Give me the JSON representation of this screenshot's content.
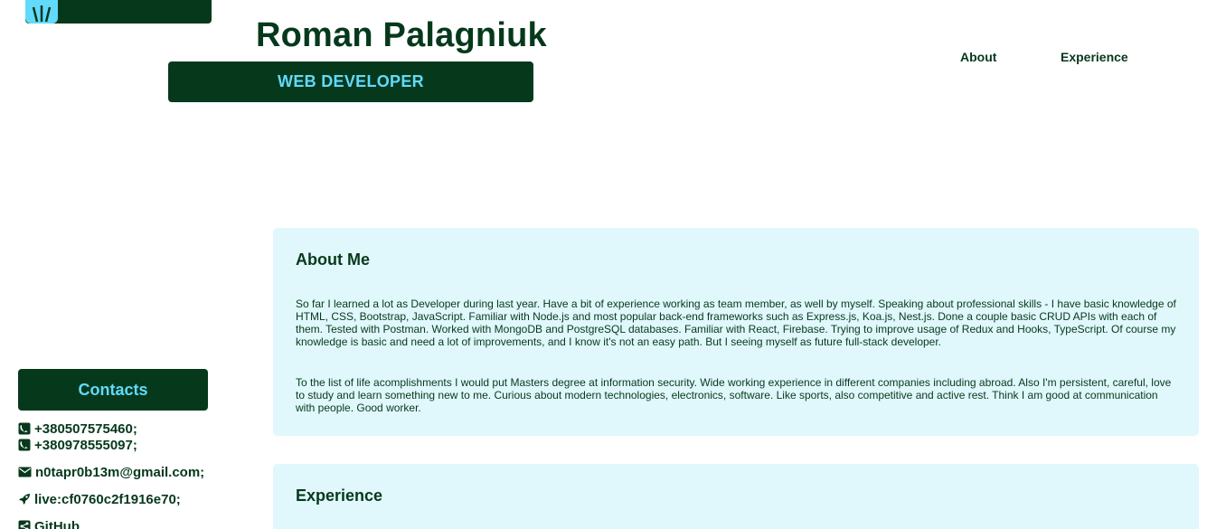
{
  "header": {
    "avatar_icon": "react-logo-icon",
    "name": "Roman Palagniuk",
    "role": "WEB DEVELOPER"
  },
  "nav": {
    "about": "About",
    "experience": "Experience"
  },
  "contacts": {
    "heading": "Contacts",
    "phone1": "+380507575460;",
    "phone2": "+380978555097;",
    "email": "n0tapr0b13m@gmail.com;",
    "skype": "live:cf0760c2f1916e70;",
    "github": "GitHub"
  },
  "about": {
    "heading": "About Me",
    "paragraph1": "So far I learned a lot as Developer during last year. Have a bit of experience working as team member, as well by myself. Speaking about professional skills - I have basic knowledge of HTML, CSS, Bootstrap, JavaScript. Familiar with Node.js and most popular back-end frameworks such as Express.js, Koa.js, Nest.js. Done a couple basic CRUD APIs with each of them. Tested with Postman. Worked with MongoDB and PostgreSQL databases. Familiar with React, Firebase. Trying to improve usage of Redux and Hooks, TypeScript. Of course my knowledge is basic and need a lot of improvements, and I know it's not an easy path. But I seeing myself as future full-stack developer.",
    "paragraph2": "To the list of life acomplishments I would put Masters degree at information security. Wide working experience in different companies including abroad. Also I'm persistent, careful, love to study and learn something new to me. Curious about modern technologies, electronics, software. Like sports, also competitive and active rest. Think I am good at communication with people. Good worker."
  },
  "experience": {
    "heading": "Experience"
  },
  "colors": {
    "dark_green": "#06391c",
    "accent_cyan": "#61dafb",
    "card_bg": "#e0f7fb"
  }
}
